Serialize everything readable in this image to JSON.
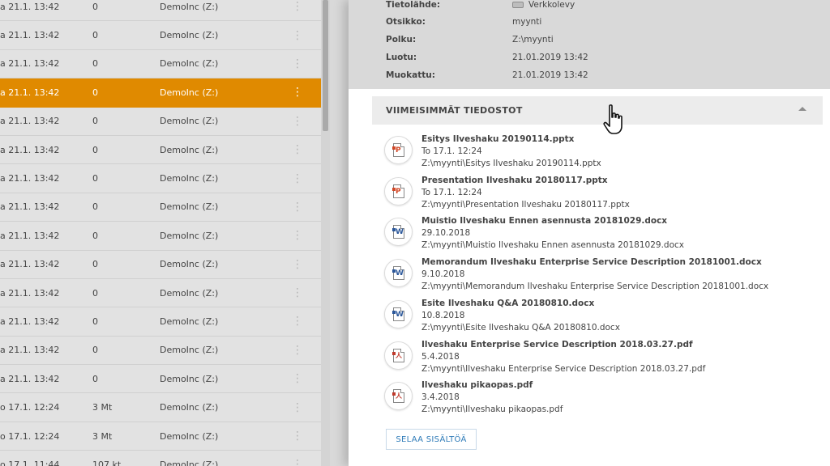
{
  "file_list": {
    "rows": [
      {
        "date": "a 21.1. 13:42",
        "size": "0",
        "source": "DemoInc (Z:)",
        "selected": false
      },
      {
        "date": "a 21.1. 13:42",
        "size": "0",
        "source": "DemoInc (Z:)",
        "selected": false
      },
      {
        "date": "a 21.1. 13:42",
        "size": "0",
        "source": "DemoInc (Z:)",
        "selected": false
      },
      {
        "date": "a 21.1. 13:42",
        "size": "0",
        "source": "DemoInc (Z:)",
        "selected": true
      },
      {
        "date": "a 21.1. 13:42",
        "size": "0",
        "source": "DemoInc (Z:)",
        "selected": false
      },
      {
        "date": "a 21.1. 13:42",
        "size": "0",
        "source": "DemoInc (Z:)",
        "selected": false
      },
      {
        "date": "a 21.1. 13:42",
        "size": "0",
        "source": "DemoInc (Z:)",
        "selected": false
      },
      {
        "date": "a 21.1. 13:42",
        "size": "0",
        "source": "DemoInc (Z:)",
        "selected": false
      },
      {
        "date": "a 21.1. 13:42",
        "size": "0",
        "source": "DemoInc (Z:)",
        "selected": false
      },
      {
        "date": "a 21.1. 13:42",
        "size": "0",
        "source": "DemoInc (Z:)",
        "selected": false
      },
      {
        "date": "a 21.1. 13:42",
        "size": "0",
        "source": "DemoInc (Z:)",
        "selected": false
      },
      {
        "date": "a 21.1. 13:42",
        "size": "0",
        "source": "DemoInc (Z:)",
        "selected": false
      },
      {
        "date": "a 21.1. 13:42",
        "size": "0",
        "source": "DemoInc (Z:)",
        "selected": false
      },
      {
        "date": "a 21.1. 13:42",
        "size": "0",
        "source": "DemoInc (Z:)",
        "selected": false
      },
      {
        "date": "o 17.1. 12:24",
        "size": "3 Mt",
        "source": "DemoInc (Z:)",
        "selected": false
      },
      {
        "date": "o 17.1. 12:24",
        "size": "3 Mt",
        "source": "DemoInc (Z:)",
        "selected": false
      },
      {
        "date": "o 17.1. 11:44",
        "size": "107 kt",
        "source": "DemoInc (Z:)",
        "selected": false
      }
    ]
  },
  "details": {
    "source_label": "Tietolähde:",
    "source_value": "Verkkolevy",
    "title_label": "Otsikko:",
    "title_value": "myynti",
    "path_label": "Polku:",
    "path_value": "Z:\\myynti",
    "created_label": "Luotu:",
    "created_value": "21.01.2019 13:42",
    "modified_label": "Muokattu:",
    "modified_value": "21.01.2019 13:42"
  },
  "recent": {
    "title": "VIIMEISIMMÄT TIEDOSTOT",
    "files": [
      {
        "name": "Esitys Ilveshaku 20190114.pptx",
        "date": "To 17.1. 12:24",
        "path": "Z:\\myynti\\Esitys Ilveshaku 20190114.pptx",
        "type": "ppt",
        "glyph": "P"
      },
      {
        "name": "Presentation Ilveshaku 20180117.pptx",
        "date": "To 17.1. 12:24",
        "path": "Z:\\myynti\\Presentation Ilveshaku 20180117.pptx",
        "type": "ppt",
        "glyph": "P"
      },
      {
        "name": "Muistio Ilveshaku Ennen asennusta 20181029.docx",
        "date": "29.10.2018",
        "path": "Z:\\myynti\\Muistio Ilveshaku Ennen asennusta 20181029.docx",
        "type": "word",
        "glyph": "W"
      },
      {
        "name": "Memorandum Ilveshaku Enterprise Service Description 20181001.docx",
        "date": "9.10.2018",
        "path": "Z:\\myynti\\Memorandum Ilveshaku Enterprise Service Description 20181001.docx",
        "type": "word",
        "glyph": "W"
      },
      {
        "name": "Esite Ilveshaku Q&A 20180810.docx",
        "date": "10.8.2018",
        "path": "Z:\\myynti\\Esite Ilveshaku Q&A 20180810.docx",
        "type": "word",
        "glyph": "W"
      },
      {
        "name": "Ilveshaku Enterprise Service Description 2018.03.27.pdf",
        "date": "5.4.2018",
        "path": "Z:\\myynti\\Ilveshaku Enterprise Service Description 2018.03.27.pdf",
        "type": "pdf",
        "glyph": "人"
      },
      {
        "name": "Ilveshaku pikaopas.pdf",
        "date": "3.4.2018",
        "path": "Z:\\myynti\\Ilveshaku pikaopas.pdf",
        "type": "pdf",
        "glyph": "人"
      }
    ],
    "browse_label": "SELAA SISÄLTÖÄ"
  },
  "icons": {
    "more": "more-vertical-icon",
    "collapse": "chevron-up-icon",
    "drive": "network-drive-icon",
    "cursor": "hand-pointer-icon"
  },
  "colors": {
    "selected_row": "#e08a00",
    "link_blue": "#2e7bb8",
    "ppt": "#d24726",
    "word": "#2b579a",
    "pdf": "#c0392b"
  }
}
